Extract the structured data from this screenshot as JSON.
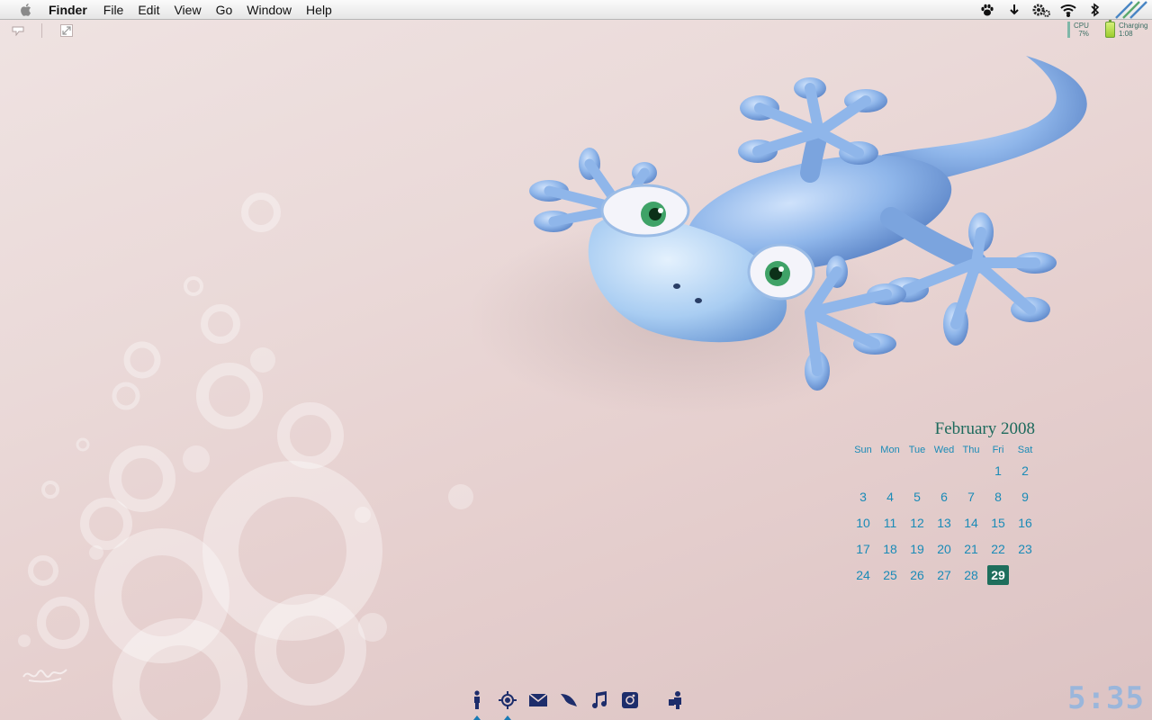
{
  "menubar": {
    "app_name": "Finder",
    "items": [
      "File",
      "Edit",
      "View",
      "Go",
      "Window",
      "Help"
    ]
  },
  "status_icons": [
    "paw-icon",
    "download-arrow-icon",
    "gears-icon",
    "wifi-icon",
    "bluetooth-icon",
    "stripes-logo-icon"
  ],
  "system_meters": {
    "cpu_label": "CPU",
    "cpu_value": "7%",
    "battery_label": "Charging",
    "battery_time": "1:08"
  },
  "calendar": {
    "title": "February 2008",
    "weekdays": [
      "Sun",
      "Mon",
      "Tue",
      "Wed",
      "Thu",
      "Fri",
      "Sat"
    ],
    "days": [
      "",
      "",
      "",
      "",
      "",
      "1",
      "2",
      "3",
      "4",
      "5",
      "6",
      "7",
      "8",
      "9",
      "10",
      "11",
      "12",
      "13",
      "14",
      "15",
      "16",
      "17",
      "18",
      "19",
      "20",
      "21",
      "22",
      "23",
      "24",
      "25",
      "26",
      "27",
      "28",
      "29",
      ""
    ],
    "today": "29"
  },
  "dock": {
    "items": [
      "person-icon",
      "compass-target-icon",
      "mail-icon",
      "leaf-icon",
      "music-note-icon",
      "photo-icon",
      "people-icon"
    ],
    "running": [
      "person-icon",
      "compass-target-icon"
    ]
  },
  "clock": {
    "time": "5:35"
  },
  "colors": {
    "accent": "#1a8bb7",
    "calendar_title": "#1c6a5c",
    "today_bg": "#1e6e5c",
    "dock_icon": "#1d2d6b",
    "clock": "#8fb4e0"
  }
}
